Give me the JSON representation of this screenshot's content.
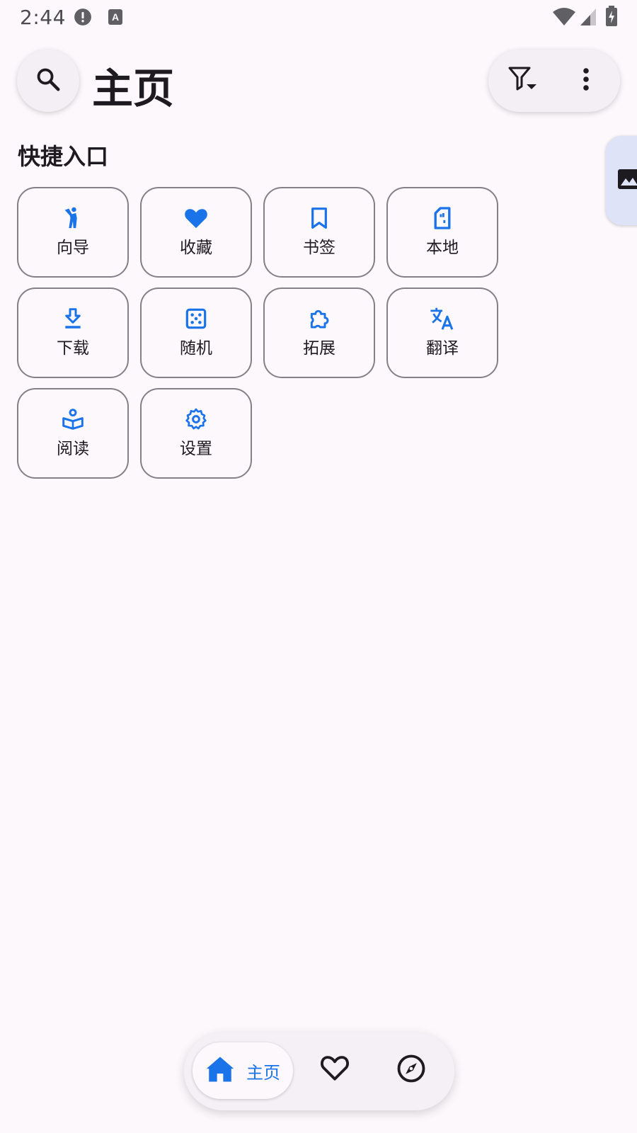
{
  "status_bar": {
    "time": "2:44",
    "icons": [
      "alert-icon",
      "text-a-icon",
      "wifi-icon",
      "signal-icon",
      "battery-charging-icon"
    ]
  },
  "top_bar": {
    "title": "主页",
    "left_icon": "search-icon",
    "right_icons": [
      "filter-icon",
      "more-vert-icon"
    ]
  },
  "side_tab": {
    "icon": "image-icon"
  },
  "quick_access": {
    "title": "快捷入口",
    "items": [
      {
        "label": "向导",
        "icon": "guide-icon"
      },
      {
        "label": "收藏",
        "icon": "heart-icon"
      },
      {
        "label": "书签",
        "icon": "bookmark-icon"
      },
      {
        "label": "本地",
        "icon": "sd-card-icon"
      },
      {
        "label": "下载",
        "icon": "download-icon"
      },
      {
        "label": "随机",
        "icon": "dice-icon"
      },
      {
        "label": "拓展",
        "icon": "extension-icon"
      },
      {
        "label": "翻译",
        "icon": "translate-icon"
      },
      {
        "label": "阅读",
        "icon": "reading-icon"
      },
      {
        "label": "设置",
        "icon": "settings-icon"
      }
    ]
  },
  "bottom_nav": {
    "items": [
      {
        "label": "主页",
        "icon": "home-icon",
        "selected": true
      },
      {
        "label": "",
        "icon": "heart-outline-icon",
        "selected": false
      },
      {
        "label": "",
        "icon": "compass-icon",
        "selected": false
      }
    ]
  },
  "colors": {
    "background": "#fcf8fc",
    "accent": "#1a73e8",
    "tile_border": "#857f88",
    "side_tab": "#dfe3f7"
  }
}
